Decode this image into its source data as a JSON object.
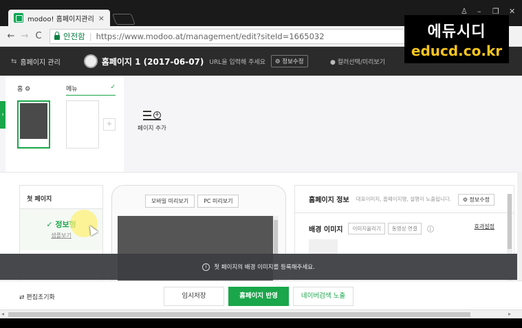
{
  "browser": {
    "tab_title": "modoo! 홈페이지관리",
    "tab_close": "×",
    "security_label": "안전함",
    "url": "https://www.modoo.at/management/edit?siteId=1665032",
    "nav_back": "←",
    "nav_forward": "→",
    "nav_reload": "C"
  },
  "watermark": {
    "korean": "에듀시디",
    "url": "educd.co.kr"
  },
  "header": {
    "management_label": "홈페이지 관리",
    "site_title": "홈페이지 1 (2017-06-07)",
    "url_hint": "URL을 입력해 주세요",
    "edit_info_button": "정보수정",
    "color_preview_label": "컬러선택/미리보기"
  },
  "pages": {
    "home_label": "홈",
    "menu_label": "메뉴",
    "add_page_label": "페이지 추가",
    "plus": "+"
  },
  "left_panel": {
    "heading": "첫 페이지",
    "type_label": "정보형",
    "sample_link": "샘플보기"
  },
  "preview": {
    "mobile_button": "모바일 미리보기",
    "pc_button": "PC 미리보기"
  },
  "right_panel": {
    "title": "홈페이지 정보",
    "description": "대표이미지, 홈페이지명, 설명이 노출됩니다.",
    "edit_button": "정보수정",
    "bg_title": "배경 이미지",
    "upload_button": "이미지올리기",
    "video_button": "동영상 연결",
    "info_icon": "i",
    "effect_setting": "효과설정"
  },
  "toast": {
    "message": "첫 페이지의 배경 이미지를 등록해주세요."
  },
  "bottom": {
    "reset_label": "편집초기화",
    "temp_save": "임시저장",
    "publish": "홈페이지 반영",
    "naver_expose": "네이버검색 노출"
  },
  "colors": {
    "brand_green": "#1aa64a",
    "header_dark": "#2b2b2b",
    "watermark_yellow": "#f7c51e"
  }
}
